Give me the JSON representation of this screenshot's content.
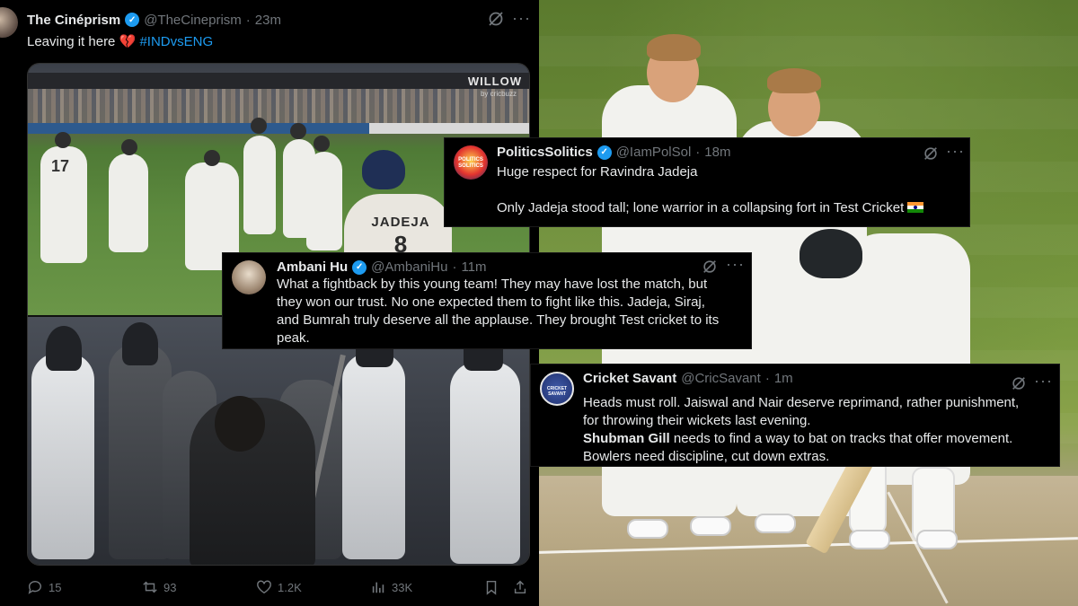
{
  "main_tweet": {
    "name": "The Cinéprism",
    "handle": "@TheCineprism",
    "time": "23m",
    "separator": "·",
    "text_prefix": "Leaving it here",
    "emoji": "💔",
    "hashtag": "#INDvsENG",
    "media": {
      "broadcaster": "WILLOW",
      "broadcaster_sub": "by cricbuzz",
      "shirt_name": "JADEJA",
      "shirt_number": "8",
      "other_number": "17"
    },
    "actions": {
      "replies": "15",
      "reposts": "93",
      "likes": "1.2K",
      "views": "33K"
    }
  },
  "overlay_tweets": [
    {
      "name": "PoliticsSolitics",
      "handle": "@IamPolSol",
      "separator": "·",
      "time": "18m",
      "avatar_text": "POLITICS SOLITICS",
      "lines": [
        "Huge respect for Ravindra Jadeja",
        "",
        "Only Jadeja stood tall;  lone warrior in a collapsing fort in Test Cricket"
      ]
    },
    {
      "name": "Ambani Hu",
      "handle": "@AmbaniHu",
      "separator": "·",
      "time": "11m",
      "lines": [
        "What a fightback by this young team! They may have lost the match, but",
        "they won our trust. No one expected them to fight like this. Jadeja, Siraj,",
        "and Bumrah truly deserve all the applause. They brought Test cricket to its",
        "peak."
      ]
    },
    {
      "name": "Cricket Savant",
      "handle": "@CricSavant",
      "separator": "·",
      "time": "1m",
      "avatar_text": "CRICKET SAVANT",
      "lines": [
        "Heads must roll. Jaiswal and Nair deserve reprimand, rather punishment,",
        "for throwing their wickets last evening."
      ],
      "bold_start": "Shubman Gill",
      "line3_rest": " needs to find a way to bat on tracks that offer movement.",
      "line4": "Bowlers need discipline, cut down extras."
    }
  ],
  "colors": {
    "accent_blue": "#1d9bf0",
    "muted": "#71767b",
    "text": "#e7e9ea",
    "background": "#000000"
  }
}
